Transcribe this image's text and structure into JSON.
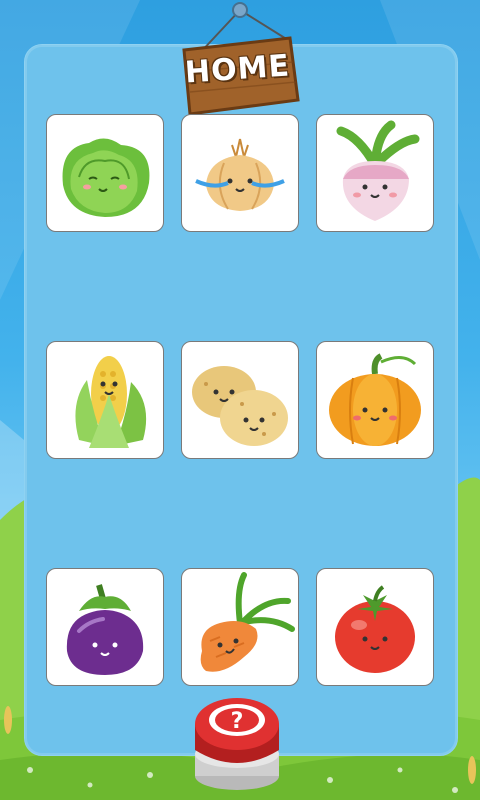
{
  "header": {
    "title": "HOME"
  },
  "help_button": {
    "glyph": "?"
  },
  "grid": [
    {
      "name": "cabbage"
    },
    {
      "name": "onion"
    },
    {
      "name": "turnip"
    },
    {
      "name": "corn"
    },
    {
      "name": "potato"
    },
    {
      "name": "pumpkin"
    },
    {
      "name": "eggplant"
    },
    {
      "name": "carrot"
    },
    {
      "name": "tomato"
    }
  ],
  "colors": {
    "sky": "#3ba9e6",
    "panel": "#6ec2ec",
    "grass": "#7ec73a",
    "sign_wood": "#a0622a",
    "button_red": "#d62a2a"
  }
}
